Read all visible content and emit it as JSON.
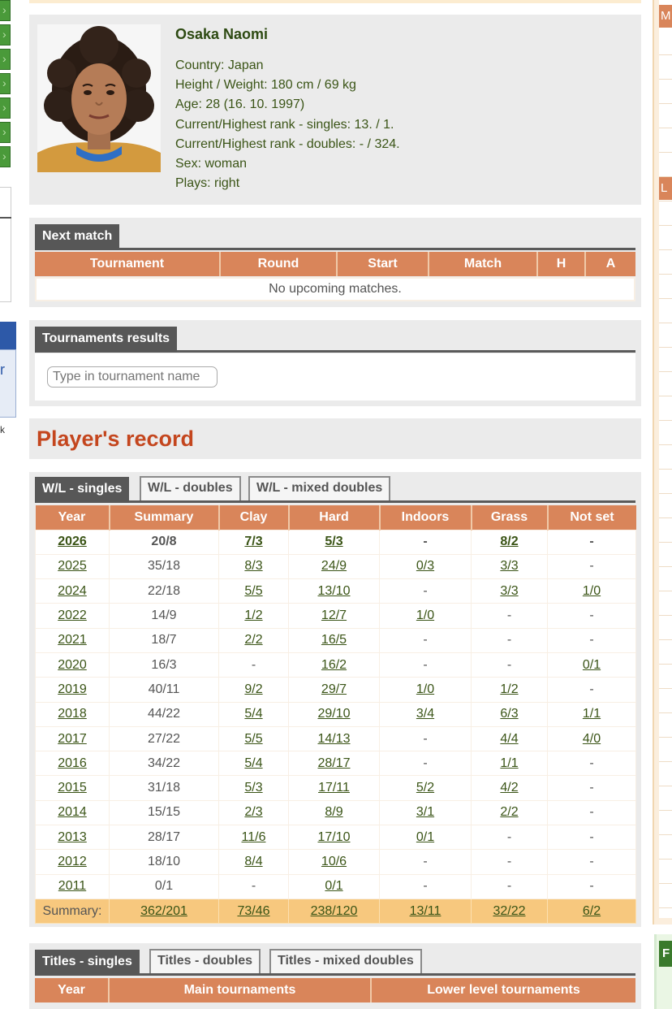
{
  "profile": {
    "name": "Osaka Naomi",
    "country": "Country: Japan",
    "height_weight": "Height / Weight: 180 cm / 69 kg",
    "age": "Age: 28 (16. 10. 1997)",
    "rank_singles": "Current/Highest rank - singles: 13. / 1.",
    "rank_doubles": "Current/Highest rank - doubles: - / 324.",
    "sex": "Sex: woman",
    "plays": "Plays: right"
  },
  "next_match": {
    "tab": "Next match",
    "columns": [
      "Tournament",
      "Round",
      "Start",
      "Match",
      "H",
      "A"
    ],
    "empty_text": "No upcoming matches."
  },
  "tournaments": {
    "tab": "Tournaments results",
    "placeholder": "Type in tournament name"
  },
  "record": {
    "title": "Player's record",
    "tabs": [
      "W/L - singles",
      "W/L - doubles",
      "W/L - mixed doubles"
    ],
    "columns": [
      "Year",
      "Summary",
      "Clay",
      "Hard",
      "Indoors",
      "Grass",
      "Not set"
    ],
    "rows": [
      [
        "2026",
        "20/8",
        "7/3",
        "5/3",
        "-",
        "8/2",
        "-"
      ],
      [
        "2025",
        "35/18",
        "8/3",
        "24/9",
        "0/3",
        "3/3",
        "-"
      ],
      [
        "2024",
        "22/18",
        "5/5",
        "13/10",
        "-",
        "3/3",
        "1/0"
      ],
      [
        "2022",
        "14/9",
        "1/2",
        "12/7",
        "1/0",
        "-",
        "-"
      ],
      [
        "2021",
        "18/7",
        "2/2",
        "16/5",
        "-",
        "-",
        "-"
      ],
      [
        "2020",
        "16/3",
        "-",
        "16/2",
        "-",
        "-",
        "0/1"
      ],
      [
        "2019",
        "40/11",
        "9/2",
        "29/7",
        "1/0",
        "1/2",
        "-"
      ],
      [
        "2018",
        "44/22",
        "5/4",
        "29/10",
        "3/4",
        "6/3",
        "1/1"
      ],
      [
        "2017",
        "27/22",
        "5/5",
        "14/13",
        "-",
        "4/4",
        "4/0"
      ],
      [
        "2016",
        "34/22",
        "5/4",
        "28/17",
        "-",
        "1/1",
        "-"
      ],
      [
        "2015",
        "31/18",
        "5/3",
        "17/11",
        "5/2",
        "4/2",
        "-"
      ],
      [
        "2014",
        "15/15",
        "2/3",
        "8/9",
        "3/1",
        "2/2",
        "-"
      ],
      [
        "2013",
        "28/17",
        "11/6",
        "17/10",
        "0/1",
        "-",
        "-"
      ],
      [
        "2012",
        "18/10",
        "8/4",
        "10/6",
        "-",
        "-",
        "-"
      ],
      [
        "2011",
        "0/1",
        "-",
        "0/1",
        "-",
        "-",
        "-"
      ]
    ],
    "summary": [
      "Summary:",
      "362/201",
      "73/46",
      "238/120",
      "13/11",
      "32/22",
      "6/2"
    ]
  },
  "titles": {
    "tabs": [
      "Titles - singles",
      "Titles - doubles",
      "Titles - mixed doubles"
    ],
    "columns": [
      "Year",
      "Main tournaments",
      "Lower level tournaments"
    ]
  },
  "sidebar_right": {
    "tag_top": "M",
    "tag_mid": "L",
    "tag_green": "F"
  },
  "sidebar_left": {
    "stub_text": "r",
    "k_text": "k"
  },
  "colors": {
    "accent": "#d9855a",
    "title_red": "#c4461e",
    "dark_tab": "#575757",
    "summary_bg": "#f7c87e",
    "green": "#3a5416"
  }
}
